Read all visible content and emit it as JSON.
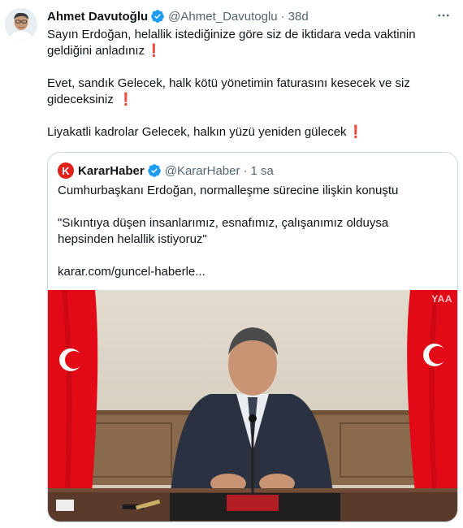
{
  "tweet": {
    "author_name": "Ahmet Davutoğlu",
    "author_handle": "@Ahmet_Davutoglu",
    "separator": "·",
    "time": "38d",
    "paragraphs": [
      "Sayın Erdoğan, helallik istediğinize göre siz de iktidara veda vaktinin geldiğini anladınız",
      "Evet, sandık Gelecek, halk kötü yönetimin faturasını kesecek ve siz gideceksiniz ",
      "Liyakatli kadrolar Gelecek, halkın yüzü yeniden gülecek"
    ],
    "exclamation_emoji": "❗"
  },
  "quoted_tweet": {
    "author_name": "KararHaber",
    "author_handle": "@KararHaber",
    "separator": "·",
    "time": "1 sa",
    "logo_letter": "K",
    "paragraphs": [
      "Cumhurbaşkanı Erdoğan, normalleşme sürecine ilişkin konuştu",
      "\"Sıkıntıya düşen insanlarımız, esnafımız, çalışanımız olduysa hepsinden helallik istiyoruz\"",
      "karar.com/guncel-haberle..."
    ],
    "media_watermark": "YAA"
  },
  "icons": {
    "verified": "verified-badge-icon",
    "more": "more-options-icon"
  },
  "colors": {
    "verified_blue": "#1d9bf0",
    "secondary_text": "#536471",
    "karar_red": "#e0221b",
    "flag_red": "#e30a17",
    "exclamation_red": "#d7261e"
  }
}
